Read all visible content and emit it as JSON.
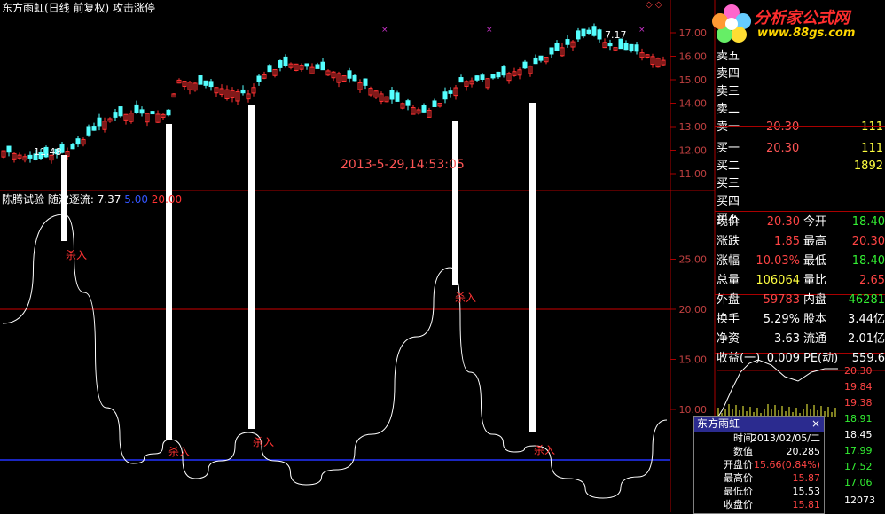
{
  "header": {
    "title": "东方雨虹(日线 前复权) 攻击涨停",
    "window_buttons": "◇ ◇"
  },
  "indicator": {
    "name": "陈腾试验",
    "label": "随波逐流: 7.37",
    "v2": "5.00",
    "v3": "20.00"
  },
  "timestamp": "2013-5-29,14:53:05",
  "logo": {
    "text1": "分析家公式网",
    "text2": "www.88gs.com"
  },
  "main_chart": {
    "y_ticks": [
      "17.00",
      "16.00",
      "15.00",
      "14.00",
      "13.00",
      "12.00",
      "11.00"
    ],
    "annotations": [
      "11.48",
      "7.17"
    ]
  },
  "ind_chart": {
    "y_ticks": [
      "25.00",
      "20.00",
      "15.00",
      "10.00"
    ],
    "signal_label": "杀入"
  },
  "order_book": {
    "asks": [
      {
        "label": "卖五",
        "price": "",
        "vol": ""
      },
      {
        "label": "卖四",
        "price": "",
        "vol": ""
      },
      {
        "label": "卖三",
        "price": "",
        "vol": ""
      },
      {
        "label": "卖二",
        "price": "",
        "vol": ""
      },
      {
        "label": "卖一",
        "price": "20.30",
        "vol": "111"
      }
    ],
    "bids": [
      {
        "label": "买一",
        "price": "20.30",
        "vol": "111"
      },
      {
        "label": "买二",
        "price": "",
        "vol": "1892"
      },
      {
        "label": "买三",
        "price": "",
        "vol": ""
      },
      {
        "label": "买四",
        "price": "",
        "vol": ""
      },
      {
        "label": "买五",
        "price": "",
        "vol": ""
      }
    ]
  },
  "stats": {
    "rows": [
      {
        "l1": "现价",
        "v1": "20.30",
        "c1": "red",
        "l2": "今开",
        "v2": "18.40",
        "c2": "grn"
      },
      {
        "l1": "涨跌",
        "v1": "1.85",
        "c1": "red",
        "l2": "最高",
        "v2": "20.30",
        "c2": "red"
      },
      {
        "l1": "涨幅",
        "v1": "10.03%",
        "c1": "red",
        "l2": "最低",
        "v2": "18.40",
        "c2": "grn"
      },
      {
        "l1": "总量",
        "v1": "106064",
        "c1": "yel",
        "l2": "量比",
        "v2": "2.65",
        "c2": "red"
      },
      {
        "l1": "外盘",
        "v1": "59783",
        "c1": "red",
        "l2": "内盘",
        "v2": "46281",
        "c2": "grn"
      },
      {
        "l1": "换手",
        "v1": "5.29%",
        "c1": "wht",
        "l2": "股本",
        "v2": "3.44亿",
        "c2": "wht"
      },
      {
        "l1": "净资",
        "v1": "3.63",
        "c1": "wht",
        "l2": "流通",
        "v2": "2.01亿",
        "c2": "wht"
      },
      {
        "l1": "收益(一)",
        "v1": "0.009",
        "c1": "wht",
        "l2": "PE(动)",
        "v2": "559.6",
        "c2": "wht"
      }
    ]
  },
  "mini_chart": {
    "ticks": [
      "20.30",
      "19.84",
      "19.38",
      "18.91",
      "18.45",
      "17.99",
      "17.52",
      "17.06",
      "12073"
    ]
  },
  "popup": {
    "title": "东方雨虹",
    "close": "×",
    "rows": [
      {
        "k": "时间",
        "v": "2013/02/05/二",
        "c": "#ffffff"
      },
      {
        "k": "数值",
        "v": "20.285",
        "c": "#ffffff"
      },
      {
        "k": "开盘价",
        "v": "15.66(0.84%)",
        "c": "#ff4444"
      },
      {
        "k": "最高价",
        "v": "15.87",
        "c": "#ff4444"
      },
      {
        "k": "最低价",
        "v": "15.53",
        "c": "#ffffff"
      },
      {
        "k": "收盘价",
        "v": "15.81",
        "c": "#ff4444"
      }
    ]
  },
  "colors": {
    "up": "#ff3232",
    "down": "#54ffff",
    "bg": "#000000",
    "grid": "#aa0000"
  }
}
